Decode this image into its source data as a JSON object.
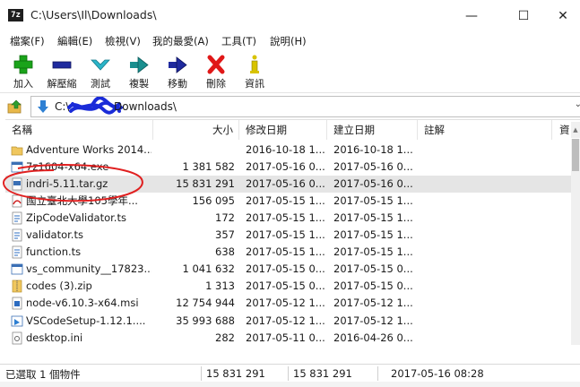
{
  "window": {
    "app_icon": "7z",
    "title": "C:\\Users\\Il\\Downloads\\",
    "controls": [
      "minimize-icon",
      "maximize-icon",
      "close-icon"
    ]
  },
  "menu": [
    "檔案(F)",
    "編輯(E)",
    "檢視(V)",
    "我的最愛(A)",
    "工具(T)",
    "說明(H)"
  ],
  "toolbar": [
    {
      "label": "加入",
      "icon": "add-icon",
      "color": "#1aa31a"
    },
    {
      "label": "解壓縮",
      "icon": "extract-icon",
      "color": "#1f2a9e"
    },
    {
      "label": "測試",
      "icon": "test-icon",
      "color": "#2bb5c9"
    },
    {
      "label": "複製",
      "icon": "copy-icon",
      "color": "#1a8f8f"
    },
    {
      "label": "移動",
      "icon": "move-icon",
      "color": "#1f2a9e"
    },
    {
      "label": "刪除",
      "icon": "delete-icon",
      "color": "#e01818"
    },
    {
      "label": "資訊",
      "icon": "info-icon",
      "color": "#d8c300"
    }
  ],
  "address": {
    "prefix": "C:\\",
    "suffix": "Downloads\\"
  },
  "columns": [
    "名稱",
    "大小",
    "修改日期",
    "建立日期",
    "註解",
    "資"
  ],
  "files": [
    {
      "name": "Adventure Works 2014...",
      "size": "",
      "modified": "2016-10-18 1...",
      "created": "2016-10-18 1...",
      "icon": "folder-icon"
    },
    {
      "name": "7z1604-x64.exe",
      "size": "1 381 582",
      "modified": "2017-05-16 0...",
      "created": "2017-05-16 0...",
      "icon": "exe-icon"
    },
    {
      "name": "indri-5.11.tar.gz",
      "size": "15 831 291",
      "modified": "2017-05-16 0...",
      "created": "2017-05-16 0...",
      "icon": "archive-icon"
    },
    {
      "name": "國立臺北大學105學年...",
      "size": "156 095",
      "modified": "2017-05-15 1...",
      "created": "2017-05-15 1...",
      "icon": "pdf-icon"
    },
    {
      "name": "ZipCodeValidator.ts",
      "size": "172",
      "modified": "2017-05-15 1...",
      "created": "2017-05-15 1...",
      "icon": "file-icon"
    },
    {
      "name": "validator.ts",
      "size": "357",
      "modified": "2017-05-15 1...",
      "created": "2017-05-15 1...",
      "icon": "file-icon"
    },
    {
      "name": "function.ts",
      "size": "638",
      "modified": "2017-05-15 1...",
      "created": "2017-05-15 1...",
      "icon": "file-icon"
    },
    {
      "name": "vs_community__17823...",
      "size": "1 041 632",
      "modified": "2017-05-15 0...",
      "created": "2017-05-15 0...",
      "icon": "exe-icon"
    },
    {
      "name": "codes (3).zip",
      "size": "1 313",
      "modified": "2017-05-15 0...",
      "created": "2017-05-15 0...",
      "icon": "zip-icon"
    },
    {
      "name": "node-v6.10.3-x64.msi",
      "size": "12 754 944",
      "modified": "2017-05-12 1...",
      "created": "2017-05-12 1...",
      "icon": "msi-icon"
    },
    {
      "name": "VSCodeSetup-1.12.1....",
      "size": "35 993 688",
      "modified": "2017-05-12 1...",
      "created": "2017-05-12 1...",
      "icon": "vscode-icon"
    },
    {
      "name": "desktop.ini",
      "size": "282",
      "modified": "2017-05-11 0...",
      "created": "2016-04-26 0...",
      "icon": "ini-icon"
    }
  ],
  "selected_index": 2,
  "status": {
    "selection": "已選取 1 個物件",
    "size": "15 831 291",
    "packed": "15 831 291",
    "date": "2017-05-16 08:28"
  },
  "colors": {
    "annotation_red": "#e02020",
    "scribble_blue": "#1a2bd8",
    "selected_row": "#e5e5e5"
  }
}
